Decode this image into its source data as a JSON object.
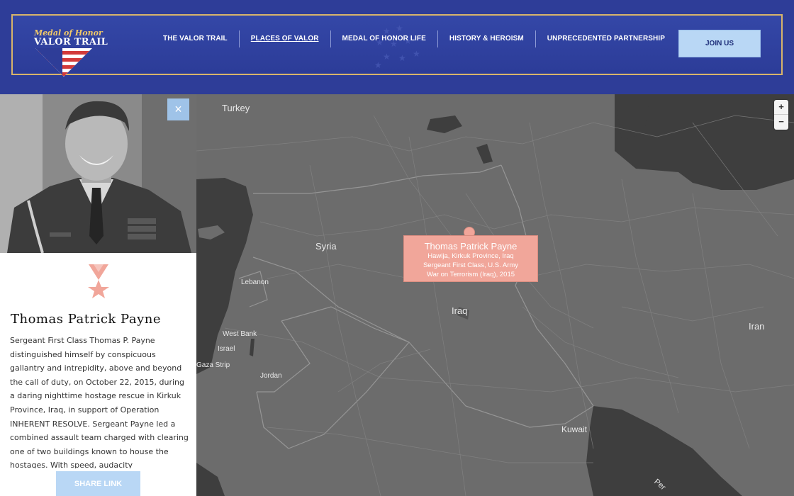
{
  "header": {
    "logo_top": "Medal of Honor",
    "logo_main": "VALOR TRAIL",
    "nav": [
      {
        "label": "THE VALOR TRAIL"
      },
      {
        "label": "PLACES OF VALOR"
      },
      {
        "label": "MEDAL OF HONOR LIFE"
      },
      {
        "label": "HISTORY & HEROISM"
      },
      {
        "label": "UNPRECEDENTED PARTNERSHIP"
      }
    ],
    "join_label": "JOIN US"
  },
  "map": {
    "labels": {
      "turkey": "Turkey",
      "syria": "Syria",
      "lebanon": "Lebanon",
      "iraq": "Iraq",
      "iran": "Iran",
      "west_bank": "West Bank",
      "israel": "Israel",
      "gaza": "Gaza Strip",
      "jordan": "Jordan",
      "kuwait": "Kuwait",
      "persian": "Per"
    },
    "zoom_in": "+",
    "zoom_out": "−",
    "popup": {
      "name": "Thomas Patrick Payne",
      "location": "Hawija, Kirkuk Province, Iraq",
      "rank": "Sergeant First Class, U.S. Army",
      "conflict": "War on Terrorism (Iraq), 2015"
    }
  },
  "sidebar": {
    "close": "×",
    "name": "Thomas Patrick Payne",
    "bio": "Sergeant First Class Thomas P. Payne distinguished himself by conspicuous gallantry and intrepidity, above and beyond the call of duty, on October 22, 2015, during a daring nighttime hostage rescue in Kirkuk Province, Iraq, in support of Operation INHERENT RESOLVE.  Sergeant Payne led a combined assault team charged with clearing one of two buildings known to house the hostages.  With speed, audacity",
    "share_label": "SHARE LINK"
  },
  "colors": {
    "header_bg": "#2e3d98",
    "frame_gold": "#d8b46a",
    "button_light_blue": "#b9d7f5",
    "popup_pink": "#f1a69a",
    "map_bg": "#6c6c6c"
  }
}
